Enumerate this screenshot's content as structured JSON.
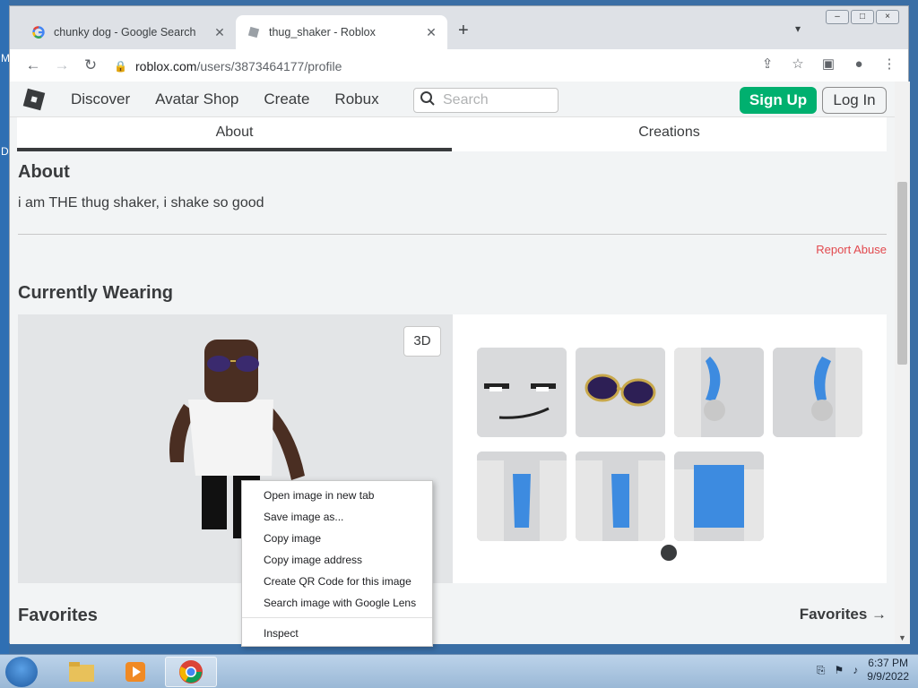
{
  "desktop": {
    "letters": [
      "M",
      "D"
    ]
  },
  "browser": {
    "tabs": [
      {
        "title": "chunky dog - Google Search",
        "active": false
      },
      {
        "title": "thug_shaker - Roblox",
        "active": true
      }
    ],
    "new_tab": "+",
    "tab_search": "⌄",
    "window_controls": [
      "–",
      "□",
      "×"
    ],
    "url_host": "roblox.com",
    "url_path": "/users/3873464177/profile"
  },
  "roblox_nav": {
    "links": [
      "Discover",
      "Avatar Shop",
      "Create",
      "Robux"
    ],
    "search_placeholder": "Search",
    "signup": "Sign Up",
    "login": "Log In"
  },
  "profile": {
    "tabs": [
      "About",
      "Creations"
    ],
    "about_heading": "About",
    "about_text": "i am THE thug shaker, i shake so good",
    "report_abuse": "Report Abuse",
    "wearing_heading": "Currently Wearing",
    "button_3d": "3D",
    "favorites_heading": "Favorites",
    "favorites_link": "Favorites →"
  },
  "context_menu": {
    "items": [
      "Open image in new tab",
      "Save image as...",
      "Copy image",
      "Copy image address",
      "Create QR Code for this image",
      "Search image with Google Lens"
    ],
    "inspect": "Inspect"
  },
  "taskbar": {
    "time": "6:37 PM",
    "date": "9/9/2022"
  },
  "colors": {
    "signup_green": "#00b06f",
    "report_red": "#e2494e",
    "text_dark": "#393b3d"
  }
}
